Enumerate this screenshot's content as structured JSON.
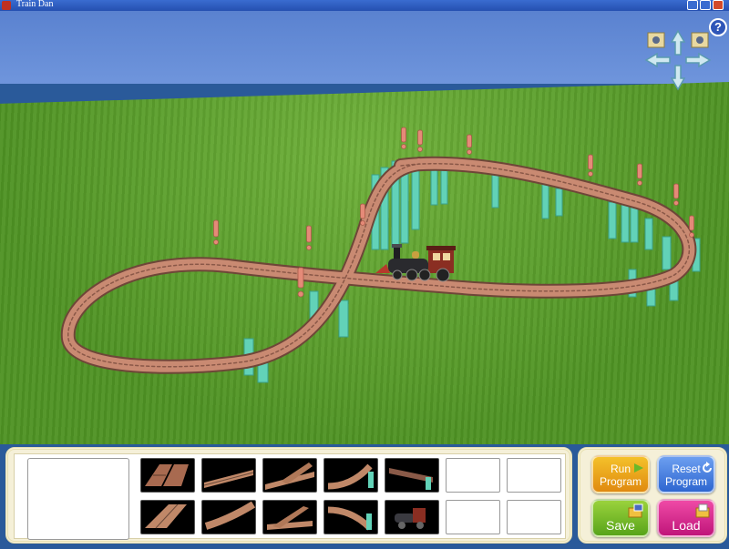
{
  "window": {
    "title": "Train Dan"
  },
  "help": {
    "label": "?"
  },
  "controls": {
    "run_label": "Run\nProgram",
    "reset_label": "Reset\nProgram",
    "save_label": "Save",
    "load_label": "Load"
  },
  "palette": {
    "pieces": [
      "double-straight-track",
      "straight-track",
      "switch-track",
      "curved-track-with-post",
      "ramp-track",
      "straight-track",
      "curved-track",
      "switch-track",
      "curved-track-with-post",
      "locomotive"
    ],
    "empty_slots": 4
  },
  "colors": {
    "sky": "#6f95dc",
    "grass": "#5c9e2c",
    "track": "#c98a72",
    "pillar": "#62d2b8",
    "marker": "#e58a78",
    "run": "#f0b020",
    "reset": "#3f78e0",
    "save": "#7cc22a",
    "load": "#e0308f"
  }
}
